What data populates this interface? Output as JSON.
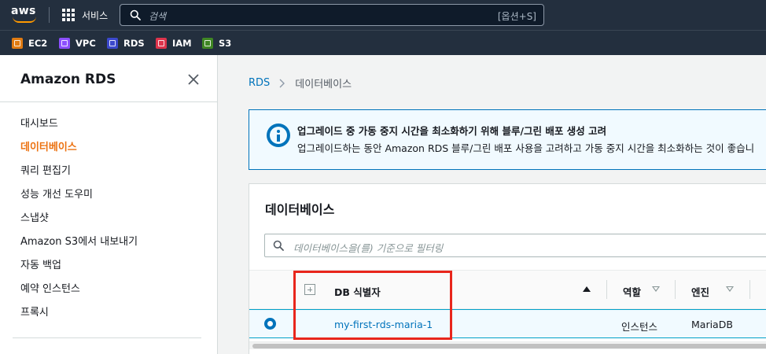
{
  "topnav": {
    "logo_text": "aws",
    "services_label": "서비스",
    "search_placeholder": "검색",
    "search_shortcut": "[옵션+S]"
  },
  "favorites": [
    {
      "label": "EC2",
      "color": "#e07b12"
    },
    {
      "label": "VPC",
      "color": "#8c4fff"
    },
    {
      "label": "RDS",
      "color": "#3b48cc"
    },
    {
      "label": "IAM",
      "color": "#dd344c"
    },
    {
      "label": "S3",
      "color": "#3f8624"
    }
  ],
  "sidebar": {
    "title": "Amazon RDS",
    "items": [
      {
        "label": "대시보드"
      },
      {
        "label": "데이터베이스"
      },
      {
        "label": "쿼리 편집기"
      },
      {
        "label": "성능 개선 도우미"
      },
      {
        "label": "스냅샷"
      },
      {
        "label": "Amazon S3에서 내보내기"
      },
      {
        "label": "자동 백업"
      },
      {
        "label": "예약 인스턴스"
      },
      {
        "label": "프록시"
      }
    ],
    "active_item": "데이터베이스"
  },
  "breadcrumb": {
    "root": "RDS",
    "current": "데이터베이스"
  },
  "alert": {
    "title": "업그레이드 중 가동 중지 시간을 최소화하기 위해 블루/그린 배포 생성 고려",
    "body": "업그레이드하는 동안 Amazon RDS 블루/그린 배포 사용을 고려하고 가동 중지 시간을 최소화하는 것이 좋습니"
  },
  "databases": {
    "title": "데이터베이스",
    "filter_placeholder": "데이터베이스을(를) 기준으로 필터링",
    "columns": [
      "DB 식별자",
      "역할",
      "엔진"
    ],
    "rows": [
      {
        "identifier": "my-first-rds-maria-1",
        "role": "인스턴스",
        "engine": "MariaDB",
        "selected": true
      }
    ]
  },
  "colors": {
    "nav_bg": "#232f3e",
    "accent_orange": "#ec7211",
    "link_blue": "#0073bb",
    "highlight_red": "#e8261c"
  }
}
